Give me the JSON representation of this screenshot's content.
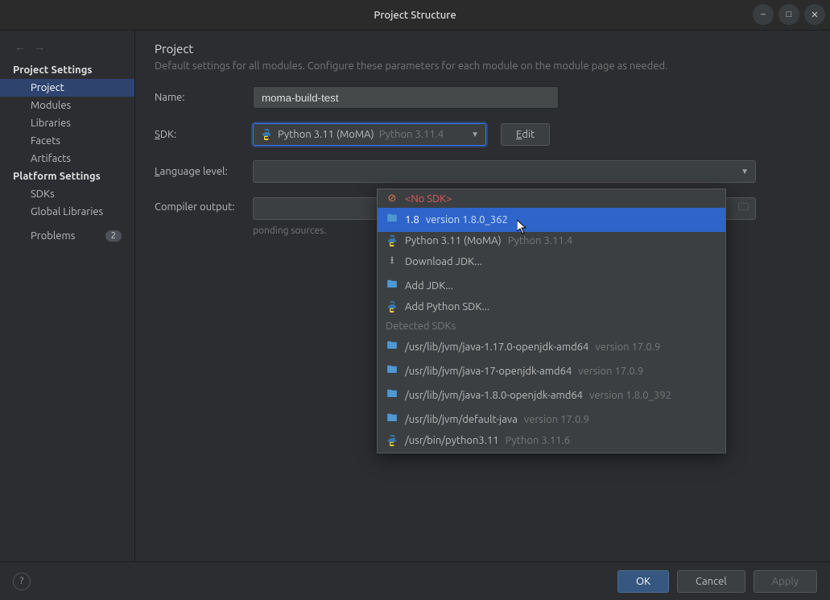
{
  "window": {
    "title": "Project Structure"
  },
  "sidebar": {
    "sections": [
      {
        "title": "Project Settings",
        "items": [
          {
            "label": "Project",
            "selected": true
          },
          {
            "label": "Modules"
          },
          {
            "label": "Libraries"
          },
          {
            "label": "Facets"
          },
          {
            "label": "Artifacts"
          }
        ]
      },
      {
        "title": "Platform Settings",
        "items": [
          {
            "label": "SDKs"
          },
          {
            "label": "Global Libraries"
          }
        ]
      }
    ],
    "problems": {
      "label": "Problems",
      "count": "2"
    }
  },
  "page": {
    "title": "Project",
    "subtitle": "Default settings for all modules. Configure these parameters for each module on the module page as needed.",
    "name_label": "Name:",
    "name_value": "moma-build-test",
    "sdk_label": "SDK:",
    "sdk_selected_main": "Python 3.11 (MoMA)",
    "sdk_selected_ver": "Python 3.11.4",
    "edit_label": "Edit",
    "lang_label_pre": "L",
    "lang_label_post": "anguage level:",
    "compiler_label": "Compiler output:",
    "compiler_hint_tail": "ponding sources."
  },
  "dropdown": {
    "items": [
      {
        "kind": "nosdk",
        "icon": "no-sdk-icon",
        "main": "<No SDK>"
      },
      {
        "kind": "sdk",
        "icon": "folder-icon",
        "main": "1.8",
        "ver": "version 1.8.0_362",
        "highlight": true
      },
      {
        "kind": "sdk",
        "icon": "python-icon",
        "main": "Python 3.11 (MoMA)",
        "ver": "Python 3.11.4"
      },
      {
        "kind": "action",
        "icon": "download-icon",
        "main": "Download JDK..."
      },
      {
        "kind": "action",
        "icon": "folder-icon",
        "main": "Add JDK..."
      },
      {
        "kind": "action",
        "icon": "python-icon",
        "main": "Add Python SDK..."
      }
    ],
    "detected_header": "Detected SDKs",
    "detected": [
      {
        "icon": "folder-icon",
        "main": "/usr/lib/jvm/java-1.17.0-openjdk-amd64",
        "ver": "version 17.0.9"
      },
      {
        "icon": "folder-icon",
        "main": "/usr/lib/jvm/java-17-openjdk-amd64",
        "ver": "version 17.0.9"
      },
      {
        "icon": "folder-icon",
        "main": "/usr/lib/jvm/java-1.8.0-openjdk-amd64",
        "ver": "version 1.8.0_392"
      },
      {
        "icon": "folder-icon",
        "main": "/usr/lib/jvm/default-java",
        "ver": "version 17.0.9"
      },
      {
        "icon": "python-icon",
        "main": "/usr/bin/python3.11",
        "ver": "Python 3.11.6"
      }
    ]
  },
  "footer": {
    "ok": "OK",
    "cancel": "Cancel",
    "apply": "Apply"
  }
}
